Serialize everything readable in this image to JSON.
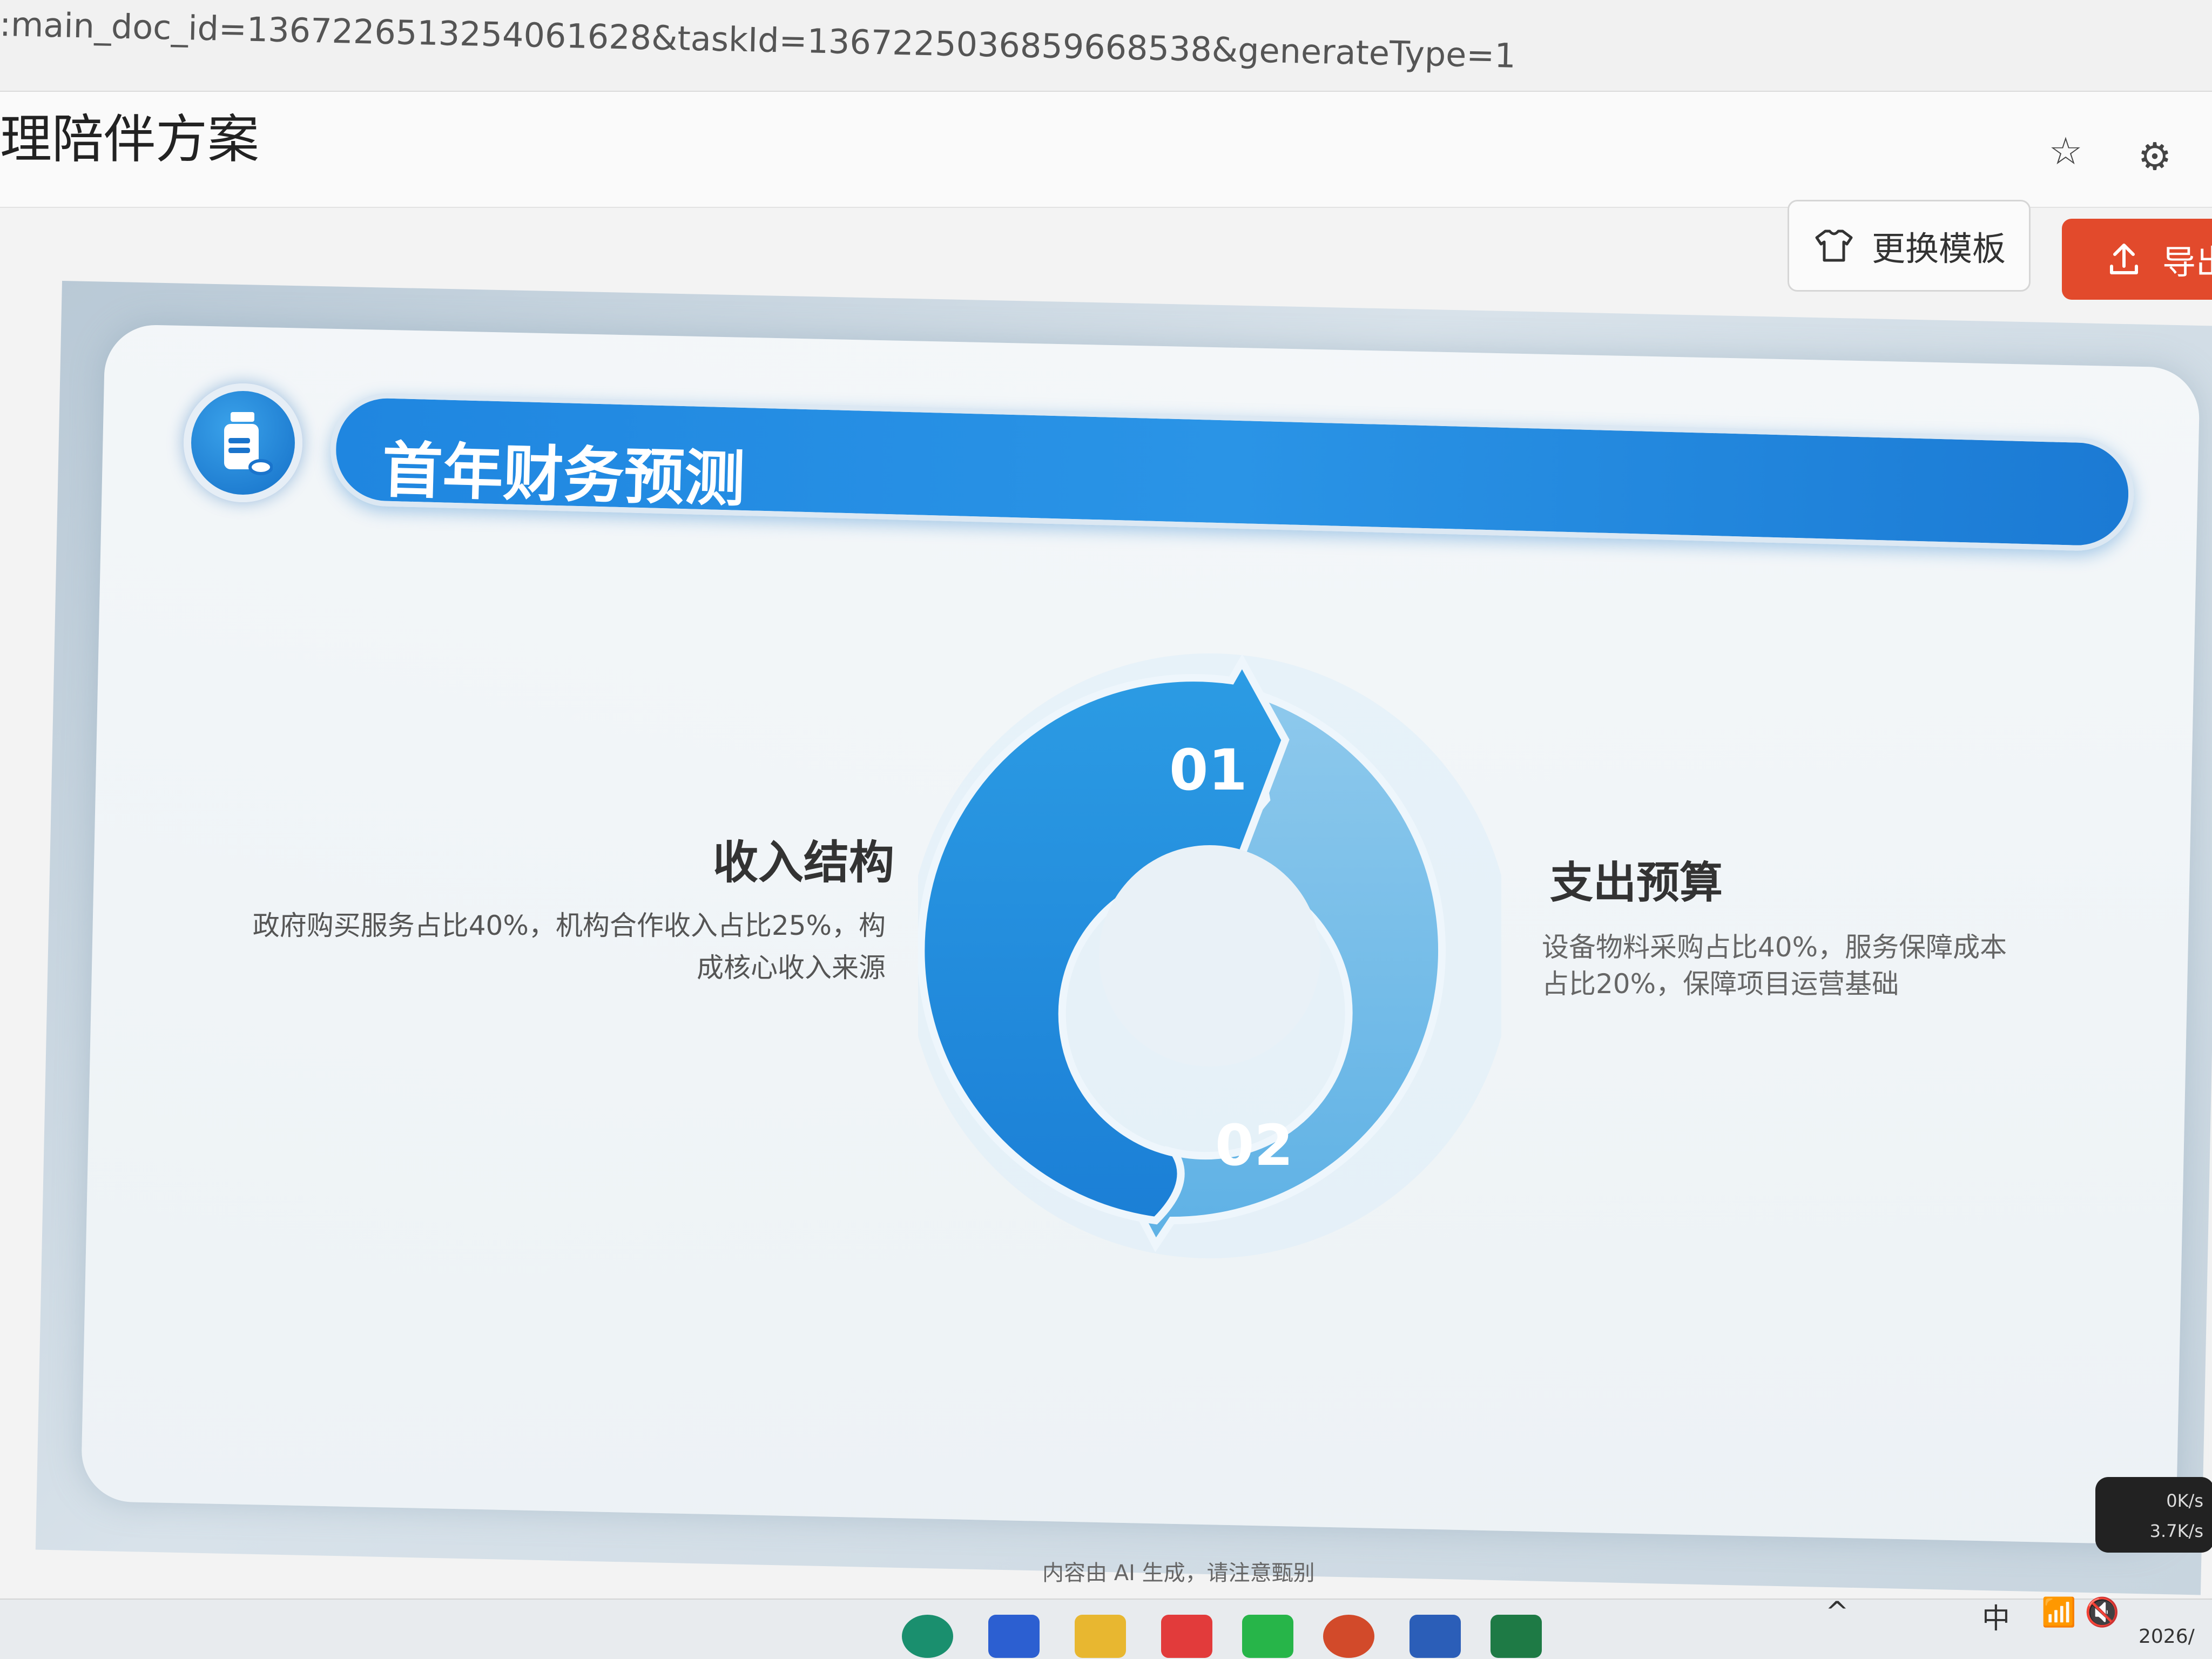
{
  "browser": {
    "url": ":main_doc_id=1367226513254061628&taskId=1367225036859668538&generateType=1"
  },
  "header": {
    "doc_title": "理陪伴方案",
    "star_icon": "☆",
    "gear_icon": "⚙"
  },
  "toolbar": {
    "template_label": "更换模板",
    "template_icon": "👕",
    "export_label": "导出",
    "export_icon": "⇪"
  },
  "slide": {
    "title": "首年财务预测",
    "icon": "medicine-bottle-icon",
    "cycle": {
      "step1": "01",
      "step2": "02"
    },
    "left": {
      "heading": "收入结构",
      "body": "政府购买服务占比40%，机构合作收入占比25%，构成核心收入来源"
    },
    "right": {
      "heading": "支出预算",
      "body": "设备物料采购占比40%，服务保障成本占比20%，保障项目运营基础"
    }
  },
  "footer": {
    "ai_note": "内容由 AI 生成，请注意甄别"
  },
  "taskbar": {
    "ime": "中",
    "tray_chevron": "^",
    "apps": [
      "edge",
      "mail",
      "files",
      "wps",
      "wechat",
      "ppt",
      "word",
      "excel"
    ],
    "net_up": "0K/s",
    "net_down": "3.7K/s",
    "date": "2026/"
  },
  "colors": {
    "accent_blue": "#1f86e0",
    "export_red": "#e24a2c"
  }
}
